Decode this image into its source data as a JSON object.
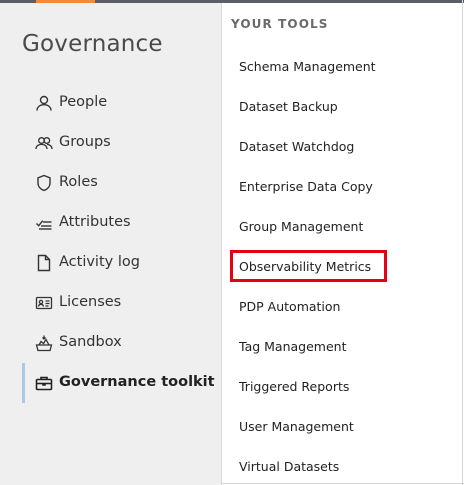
{
  "sidebar": {
    "title": "Governance",
    "items": [
      {
        "label": "People",
        "icon": "person-icon"
      },
      {
        "label": "Groups",
        "icon": "group-icon"
      },
      {
        "label": "Roles",
        "icon": "shield-icon"
      },
      {
        "label": "Attributes",
        "icon": "checklist-icon"
      },
      {
        "label": "Activity log",
        "icon": "document-icon"
      },
      {
        "label": "Licenses",
        "icon": "id-card-icon"
      },
      {
        "label": "Sandbox",
        "icon": "sandbox-icon"
      },
      {
        "label": "Governance toolkit",
        "icon": "toolbox-icon",
        "active": true
      }
    ]
  },
  "tools": {
    "heading": "YOUR TOOLS",
    "items": [
      "Schema Management",
      "Dataset Backup",
      "Dataset Watchdog",
      "Enterprise Data Copy",
      "Group Management",
      "Observability Metrics",
      "PDP Automation",
      "Tag Management",
      "Triggered Reports",
      "User Management",
      "Virtual Datasets"
    ],
    "highlighted": "Observability Metrics"
  },
  "colors": {
    "accent": "#f08a3c",
    "highlight": "#e60012",
    "active_indicator": "#a9c8ea",
    "sidebar_bg": "#efefef"
  }
}
